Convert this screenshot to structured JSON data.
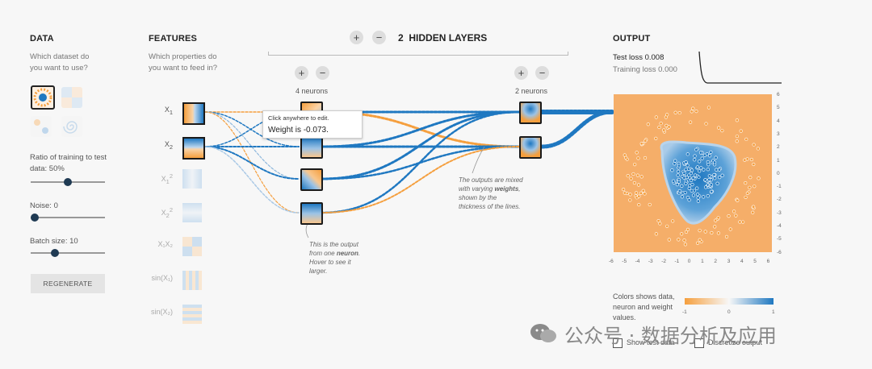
{
  "data_section": {
    "title": "DATA",
    "question": "Which dataset do you want to use?",
    "ratio_label": "Ratio of training to test data:",
    "ratio_value": "50%",
    "ratio_fraction": 0.5,
    "noise_label": "Noise:",
    "noise_value": "0",
    "noise_fraction": 0.0,
    "batch_label": "Batch size:",
    "batch_value": "10",
    "batch_fraction": 0.3,
    "regenerate": "REGENERATE"
  },
  "features_section": {
    "title": "FEATURES",
    "question": "Which properties do you want to feed in?",
    "items": [
      {
        "label": "X",
        "sub": "1",
        "sup": ""
      },
      {
        "label": "X",
        "sub": "2",
        "sup": ""
      },
      {
        "label": "X",
        "sub": "1",
        "sup": "2"
      },
      {
        "label": "X",
        "sub": "2",
        "sup": "2"
      },
      {
        "label": "X₁X₂",
        "sub": "",
        "sup": ""
      },
      {
        "label": "sin(X₁)",
        "sub": "",
        "sup": ""
      },
      {
        "label": "sin(X₂)",
        "sub": "",
        "sup": ""
      }
    ]
  },
  "network": {
    "add": "+",
    "remove": "−",
    "layer_count": "2",
    "layers_label": "HIDDEN LAYERS",
    "layer1_neurons": "4 neurons",
    "layer2_neurons": "2 neurons"
  },
  "tooltip": {
    "hint": "Click anywhere to edit.",
    "weight_text": "Weight is -0.073."
  },
  "annotations": {
    "weights_pre": "The outputs are mixed with varying",
    "weights_bold": "weights",
    "weights_post": ", shown by the thickness of the lines.",
    "neuron_pre": "This is the output from one",
    "neuron_bold": "neuron",
    "neuron_post": ". Hover to see it larger."
  },
  "output_section": {
    "title": "OUTPUT",
    "test_loss": "Test loss 0.008",
    "training_loss": "Training loss 0.000",
    "y_ticks": [
      "5",
      "4",
      "3",
      "2",
      "1",
      "0",
      "-1",
      "-2",
      "-3",
      "-4",
      "-5"
    ],
    "x_ticks": [
      "-6",
      "-5",
      "-4",
      "-3",
      "-2",
      "-1",
      "0",
      "1",
      "2",
      "3",
      "4",
      "5",
      "6"
    ],
    "right_ticks": [
      "6",
      "5",
      "4",
      "3",
      "2",
      "1",
      "0",
      "-1",
      "-2",
      "-3",
      "-4",
      "-5",
      "-6"
    ],
    "legend_text": "Colors shows data, neuron and weight values.",
    "legend_min": "-1",
    "legend_mid": "0",
    "legend_max": "1",
    "show_test": "Show test data",
    "discretize": "Discretize output"
  },
  "watermark": "公众号 · 数据分析及应用",
  "colors": {
    "orange": "#f59f3e",
    "blue": "#1f78c1",
    "dark": "#1a1a1a"
  }
}
